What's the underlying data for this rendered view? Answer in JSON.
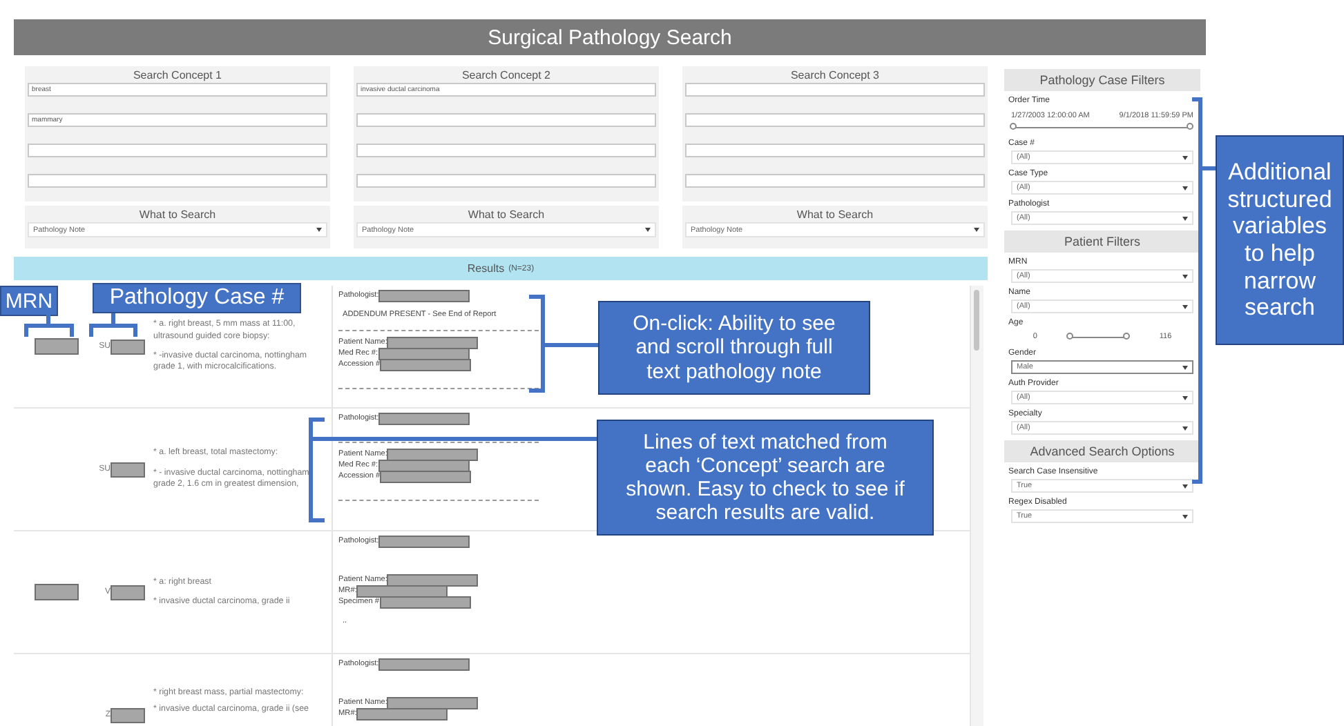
{
  "title": "Surgical Pathology Search",
  "concepts": [
    {
      "header": "Search Concept 1",
      "fields": [
        {
          "value": "breast"
        },
        {
          "value": "mammary"
        }
      ],
      "what_to_search": {
        "label": "What to Search",
        "value": "Pathology Note"
      }
    },
    {
      "header": "Search Concept 2",
      "fields": [
        {
          "value": "invasive ductal carcinoma"
        }
      ],
      "what_to_search": {
        "label": "What to Search",
        "value": "Pathology Note"
      }
    },
    {
      "header": "Search Concept 3",
      "what_to_search": {
        "label": "What to Search",
        "value": "Pathology Note"
      }
    }
  ],
  "results_bar": {
    "title": "Results",
    "count": "(N=23)"
  },
  "results": [
    {
      "mrn_redacted": true,
      "case_prefix": "SU",
      "snippets": [
        "* a.  right breast, 5 mm mass at 11:00, ultrasound guided core biopsy:",
        "* -invasive ductal carcinoma, nottingham grade 1, with microcalcifications."
      ],
      "note": [
        {
          "kind": "field",
          "label": "Pathologist:"
        },
        {
          "kind": "text",
          "text": "ADDENDUM PRESENT - See End of Report"
        },
        {
          "kind": "rule"
        },
        {
          "kind": "field",
          "label": "Patient Name:"
        },
        {
          "kind": "field",
          "label": "Med Rec #:"
        },
        {
          "kind": "field",
          "label": "Accession #"
        },
        {
          "kind": "spacer"
        },
        {
          "kind": "rule"
        }
      ]
    },
    {
      "mrn_redacted": false,
      "case_prefix": "SU",
      "snippets": [
        "* a. left breast, total mastectomy:",
        "* - invasive ductal carcinoma, nottingham grade 2, 1.6 cm in greatest dimension,"
      ],
      "note": [
        {
          "kind": "field",
          "label": "Pathologist:"
        },
        {
          "kind": "spacer"
        },
        {
          "kind": "rule"
        },
        {
          "kind": "field",
          "label": "Patient Name:"
        },
        {
          "kind": "field",
          "label": "Med Rec #:"
        },
        {
          "kind": "field",
          "label": "Accession #"
        },
        {
          "kind": "spacer"
        },
        {
          "kind": "rule"
        }
      ]
    },
    {
      "mrn_redacted": true,
      "case_prefix": "V",
      "snippets": [
        "* a: right breast",
        "* invasive ductal carcinoma, grade ii"
      ],
      "note": [
        {
          "kind": "field",
          "label": "Pathologist:"
        },
        {
          "kind": "spacer"
        },
        {
          "kind": "spacer"
        },
        {
          "kind": "field",
          "label": "Patient Name:"
        },
        {
          "kind": "field",
          "label": "MR#:"
        },
        {
          "kind": "field",
          "label": "Specimen #"
        },
        {
          "kind": "text",
          "text": ".."
        }
      ]
    },
    {
      "mrn_redacted": false,
      "case_prefix": "Z",
      "snippets": [
        "* right breast mass, partial mastectomy:",
        "* invasive ductal carcinoma, grade ii (see"
      ],
      "note": [
        {
          "kind": "field",
          "label": "Pathologist:"
        },
        {
          "kind": "spacer"
        },
        {
          "kind": "spacer"
        },
        {
          "kind": "field",
          "label": "Patient Name:"
        },
        {
          "kind": "field",
          "label": "MR#:"
        }
      ]
    }
  ],
  "filter_sections": [
    {
      "title": "Pathology Case Filters",
      "filters": [
        {
          "kind": "range",
          "label": "Order Time",
          "min": "1/27/2003 12:00:00 AM",
          "max": "9/1/2018 11:59:59 PM",
          "thumbs": [
            {
              "level": 0
            },
            {
              "level": 1
            }
          ]
        },
        {
          "kind": "dropdown",
          "label": "Case #",
          "value": "(All)",
          "highlighted": false
        },
        {
          "kind": "dropdown",
          "label": "Case Type",
          "value": "(All)",
          "highlighted": false
        },
        {
          "kind": "dropdown",
          "label": "Pathologist",
          "value": "(All)",
          "highlighted": false
        }
      ]
    },
    {
      "title": "Patient Filters",
      "filters": [
        {
          "kind": "dropdown",
          "label": "MRN",
          "value": "(All)",
          "highlighted": false
        },
        {
          "kind": "dropdown",
          "label": "Name",
          "value": "(All)",
          "highlighted": false
        },
        {
          "kind": "slider",
          "label": "Age",
          "min": "0",
          "max": "116",
          "thumbs": [
            {
              "level": 0
            },
            {
              "level": 1
            }
          ]
        },
        {
          "kind": "dropdown",
          "label": "Gender",
          "value": "Male",
          "highlighted": true
        },
        {
          "kind": "dropdown",
          "label": "Auth Provider",
          "value": "(All)",
          "highlighted": false
        },
        {
          "kind": "dropdown",
          "label": "Specialty",
          "value": "(All)",
          "highlighted": false
        }
      ]
    },
    {
      "title": "Advanced Search Options",
      "filters": [
        {
          "kind": "dropdown",
          "label": "Search Case Insensitive",
          "value": "True",
          "highlighted": false
        },
        {
          "kind": "dropdown",
          "label": "Regex Disabled",
          "value": "True",
          "highlighted": false
        }
      ]
    }
  ],
  "annotations": [
    {
      "kind": "label",
      "text": "MRN"
    },
    {
      "kind": "label",
      "text": "Pathology Case #"
    },
    {
      "kind": "callout",
      "text": "On-click: Ability to see and scroll through full text pathology note"
    },
    {
      "kind": "callout",
      "text": "Lines of text matched from each ‘Concept’ search are shown. Easy to check to see if search results are valid."
    },
    {
      "kind": "callout",
      "text": "Additional structured variables to help narrow search"
    }
  ]
}
